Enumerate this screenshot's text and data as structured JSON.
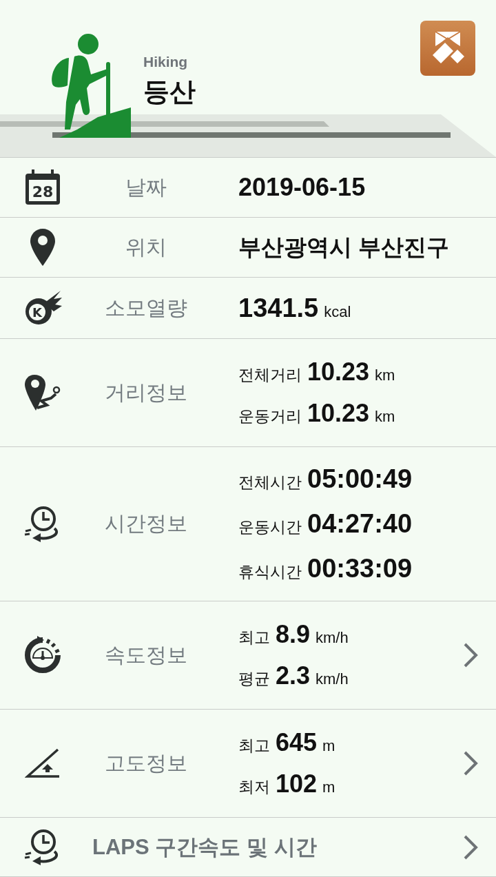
{
  "header": {
    "subtitle": "Hiking",
    "title": "등산"
  },
  "rows": [
    {
      "kind": "single",
      "icon_text": "28",
      "label": "날짜",
      "value": "2019-06-15",
      "has_arrow": false
    },
    {
      "kind": "single",
      "label": "위치",
      "value": "부산광역시 부산진구",
      "has_arrow": false
    },
    {
      "kind": "single",
      "icon_text": "K",
      "label": "소모열량",
      "value": "1341.5",
      "unit": "kcal",
      "has_arrow": false
    },
    {
      "kind": "multi",
      "label": "거리정보",
      "has_arrow": false,
      "lines": [
        {
          "label": "전체거리",
          "value": "10.23",
          "unit": "km"
        },
        {
          "label": "운동거리",
          "value": "10.23",
          "unit": "km"
        }
      ]
    },
    {
      "kind": "multi",
      "label": "시간정보",
      "has_arrow": false,
      "lines": [
        {
          "label": "전체시간",
          "value": "05:00:49"
        },
        {
          "label": "운동시간",
          "value": "04:27:40"
        },
        {
          "label": "휴식시간",
          "value": "00:33:09"
        }
      ]
    },
    {
      "kind": "multi",
      "label": "속도정보",
      "has_arrow": true,
      "lines": [
        {
          "label": "최고",
          "value": "8.9",
          "unit": "km/h"
        },
        {
          "label": "평균",
          "value": "2.3",
          "unit": "km/h"
        }
      ]
    },
    {
      "kind": "multi",
      "label": "고도정보",
      "has_arrow": true,
      "lines": [
        {
          "label": "최고",
          "value": "645",
          "unit": "m"
        },
        {
          "label": "최저",
          "value": "102",
          "unit": "m"
        }
      ]
    },
    {
      "kind": "laps",
      "label": "LAPS 구간속도 및 시간",
      "has_arrow": true
    }
  ]
}
